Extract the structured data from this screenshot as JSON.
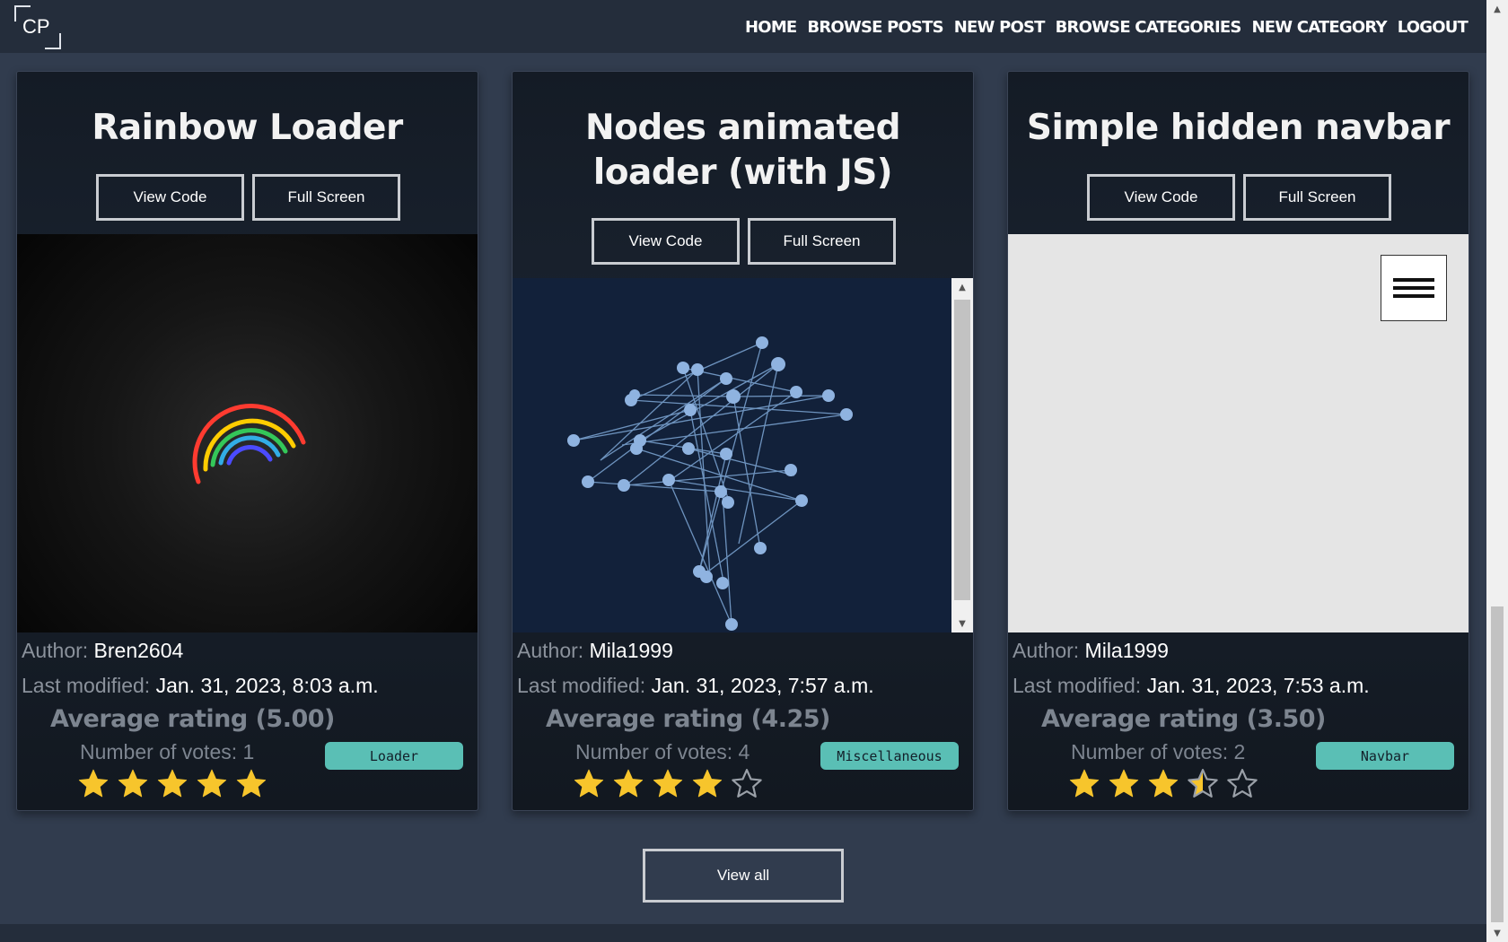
{
  "nav": {
    "logo": "CP",
    "links": [
      "HOME",
      "BROWSE POSTS",
      "NEW POST",
      "BROWSE CATEGORIES",
      "NEW CATEGORY",
      "LOGOUT"
    ]
  },
  "labels": {
    "view_code": "View Code",
    "full_screen": "Full Screen",
    "author": "Author:",
    "last_modified": "Last modified:",
    "view_all": "View all"
  },
  "posts": [
    {
      "title": "Rainbow Loader",
      "author": "Bren2604",
      "modified": "Jan. 31, 2023, 8:03 a.m.",
      "avg": "Average rating (5.00)",
      "votes": "Number of votes: 1",
      "rating": 5.0,
      "category": "Loader"
    },
    {
      "title": "Nodes animated loader (with JS)",
      "author": "Mila1999",
      "modified": "Jan. 31, 2023, 7:57 a.m.",
      "avg": "Average rating (4.25)",
      "votes": "Number of votes: 4",
      "rating": 4.0,
      "category": "Miscellaneous"
    },
    {
      "title": "Simple hidden navbar",
      "author": "Mila1999",
      "modified": "Jan. 31, 2023, 7:53 a.m.",
      "avg": "Average rating (3.50)",
      "votes": "Number of votes: 2",
      "rating": 3.5,
      "category": "Navbar"
    }
  ],
  "colors": {
    "star": "#f7c52c",
    "badge": "#5abfb5",
    "background": "#313c4e",
    "navbar": "#242d3b"
  }
}
